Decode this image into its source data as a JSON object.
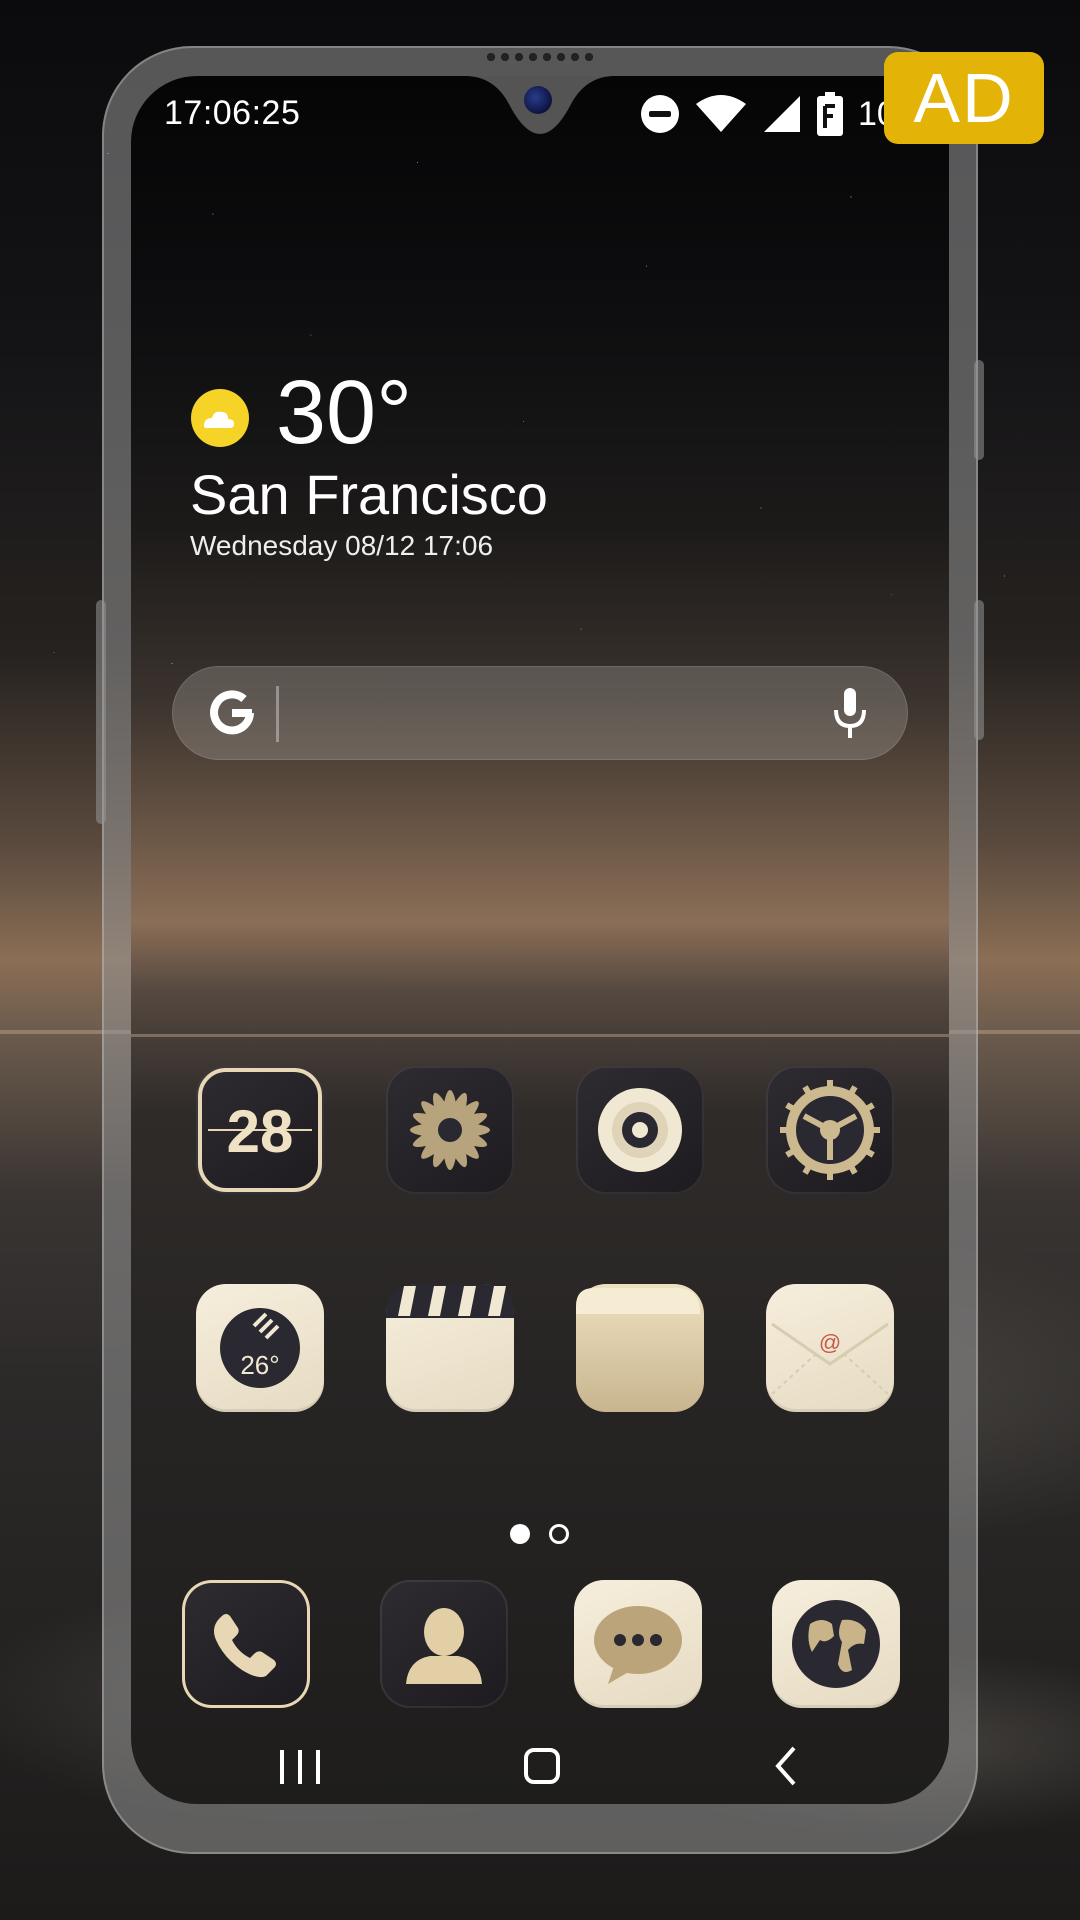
{
  "status_bar": {
    "time": "17:06:25",
    "battery_text": "100",
    "icons": [
      "do-not-disturb-icon",
      "wifi-icon",
      "signal-icon",
      "battery-icon"
    ]
  },
  "ad_badge": {
    "label": "AD",
    "color": "#e3b407"
  },
  "weather": {
    "icon": "partly-cloudy-icon",
    "temperature": "30°",
    "city": "San Francisco",
    "datetime": "Wednesday 08/12 17:06"
  },
  "search": {
    "logo": "google-g-icon",
    "mic": "microphone-icon"
  },
  "apps_row1": [
    {
      "name": "calendar-app-icon",
      "label": "28"
    },
    {
      "name": "gallery-app-icon"
    },
    {
      "name": "camera-app-icon"
    },
    {
      "name": "settings-app-icon"
    }
  ],
  "apps_row2": [
    {
      "name": "weather-app-icon",
      "label": "26°"
    },
    {
      "name": "video-app-icon"
    },
    {
      "name": "files-app-icon"
    },
    {
      "name": "email-app-icon",
      "label": "@"
    }
  ],
  "dock": [
    {
      "name": "phone-app-icon"
    },
    {
      "name": "contacts-app-icon"
    },
    {
      "name": "messages-app-icon"
    },
    {
      "name": "browser-app-icon"
    }
  ],
  "page_indicator": {
    "count": 2,
    "active": 1
  },
  "nav_bar": [
    "recents-icon",
    "home-icon",
    "back-icon"
  ],
  "colors": {
    "accent_gold": "#c9b48a",
    "tile_dark": "#2a282c",
    "tile_cream": "#f1e8d4"
  }
}
